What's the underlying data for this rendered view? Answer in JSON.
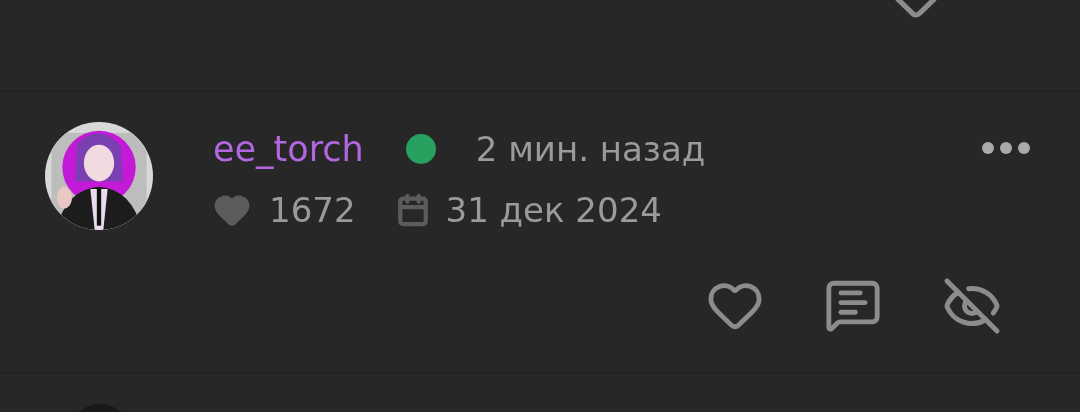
{
  "post": {
    "author": "ee_torch",
    "online": true,
    "time": "2 мин. назад",
    "likes": "1672",
    "date": "31 дек 2024"
  }
}
